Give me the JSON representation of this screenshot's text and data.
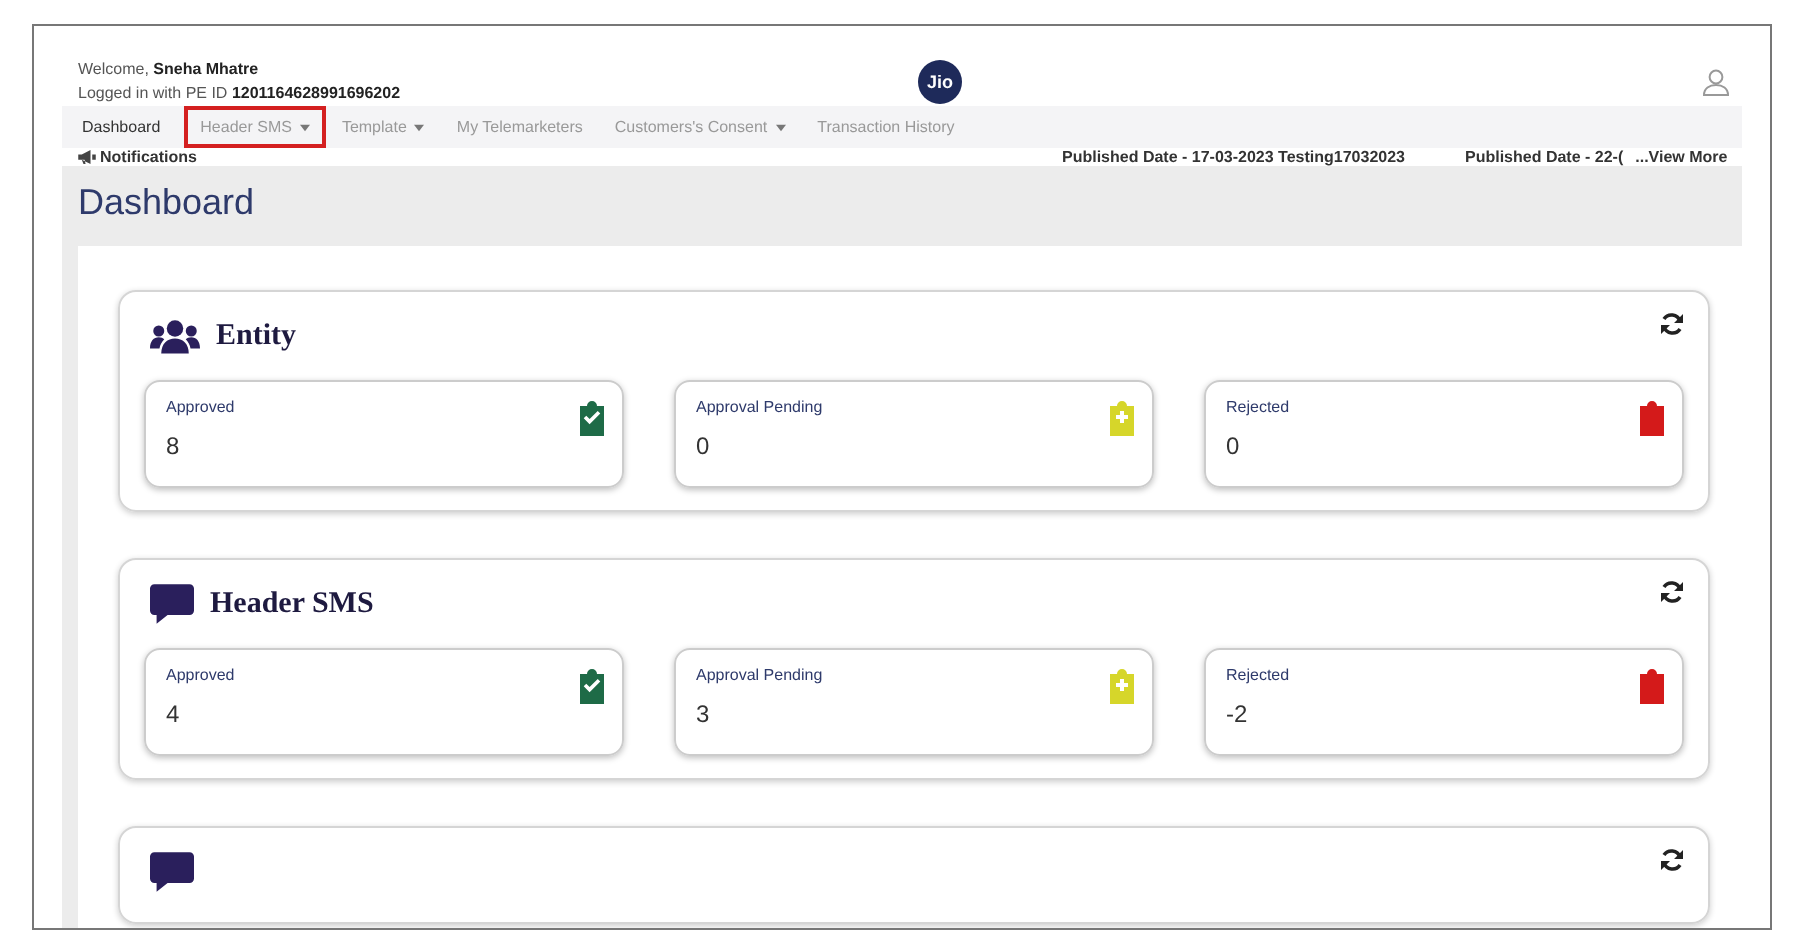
{
  "header": {
    "welcome_label": "Welcome,",
    "user_name": "Sneha Mhatre",
    "pe_label": "Logged in with PE ID",
    "pe_id": "1201164628991696202",
    "logo": "Jio"
  },
  "nav": [
    {
      "label": "Dashboard",
      "selected": true,
      "dropdown": false,
      "highlighted": false
    },
    {
      "label": "Header SMS",
      "selected": false,
      "dropdown": true,
      "highlighted": true
    },
    {
      "label": "Template",
      "selected": false,
      "dropdown": true,
      "highlighted": false
    },
    {
      "label": "My Telemarketers",
      "selected": false,
      "dropdown": false,
      "highlighted": false
    },
    {
      "label": "Customers's Consent",
      "selected": false,
      "dropdown": true,
      "highlighted": false
    },
    {
      "label": "Transaction History",
      "selected": false,
      "dropdown": false,
      "highlighted": false
    }
  ],
  "notifications": {
    "label": "Notifications",
    "items": [
      "Published Date - 17-03-2023 Testing17032023",
      "Published Date - 22-("
    ],
    "more": "...View More"
  },
  "page_title": "Dashboard",
  "sections": [
    {
      "kind": "users",
      "title": "Entity",
      "stats": [
        {
          "kind": "approved",
          "label": "Approved",
          "value": "8"
        },
        {
          "kind": "pending",
          "label": "Approval Pending",
          "value": "0"
        },
        {
          "kind": "rejected",
          "label": "Rejected",
          "value": "0"
        }
      ]
    },
    {
      "kind": "chat",
      "title": "Header SMS",
      "stats": [
        {
          "kind": "approved",
          "label": "Approved",
          "value": "4"
        },
        {
          "kind": "pending",
          "label": "Approval Pending",
          "value": "3"
        },
        {
          "kind": "rejected",
          "label": "Rejected",
          "value": "-2"
        }
      ]
    },
    {
      "kind": "chat"
    }
  ]
}
